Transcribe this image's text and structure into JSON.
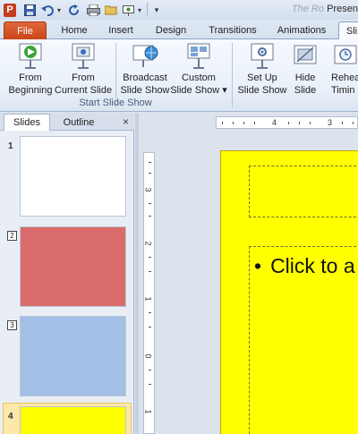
{
  "quick_access": {
    "app_icon": "P",
    "title": "Presen",
    "title_faded": "The Ro"
  },
  "tabs": {
    "file": "File",
    "home": "Home",
    "insert": "Insert",
    "design": "Design",
    "transitions": "Transitions",
    "animations": "Animations",
    "slideshow": "Sli"
  },
  "ribbon": {
    "from_beginning": [
      "From",
      "Beginning"
    ],
    "from_current": [
      "From",
      "Current Slide"
    ],
    "broadcast": [
      "Broadcast",
      "Slide Show"
    ],
    "custom": [
      "Custom",
      "Slide Show ▾"
    ],
    "setup": [
      "Set Up",
      "Slide Show"
    ],
    "hide": [
      "Hide",
      "Slide"
    ],
    "rehearse": [
      "Rehea",
      "Timin"
    ],
    "group_start": "Start Slide Show"
  },
  "pane": {
    "tab_slides": "Slides",
    "tab_outline": "Outline",
    "close": "×",
    "slides": [
      {
        "num": "1",
        "color": "#ffffff"
      },
      {
        "num": "2",
        "color": "#d96c6a"
      },
      {
        "num": "3",
        "color": "#a4bfe6"
      },
      {
        "num": "4",
        "color": "#ffff00"
      }
    ]
  },
  "ruler": {
    "h_marks": [
      "4",
      "3"
    ],
    "v_marks": [
      "3",
      "2",
      "1",
      "0",
      "1"
    ]
  },
  "slide": {
    "body_text": "Click to a",
    "bullet": "•",
    "background": "#ffff00"
  }
}
